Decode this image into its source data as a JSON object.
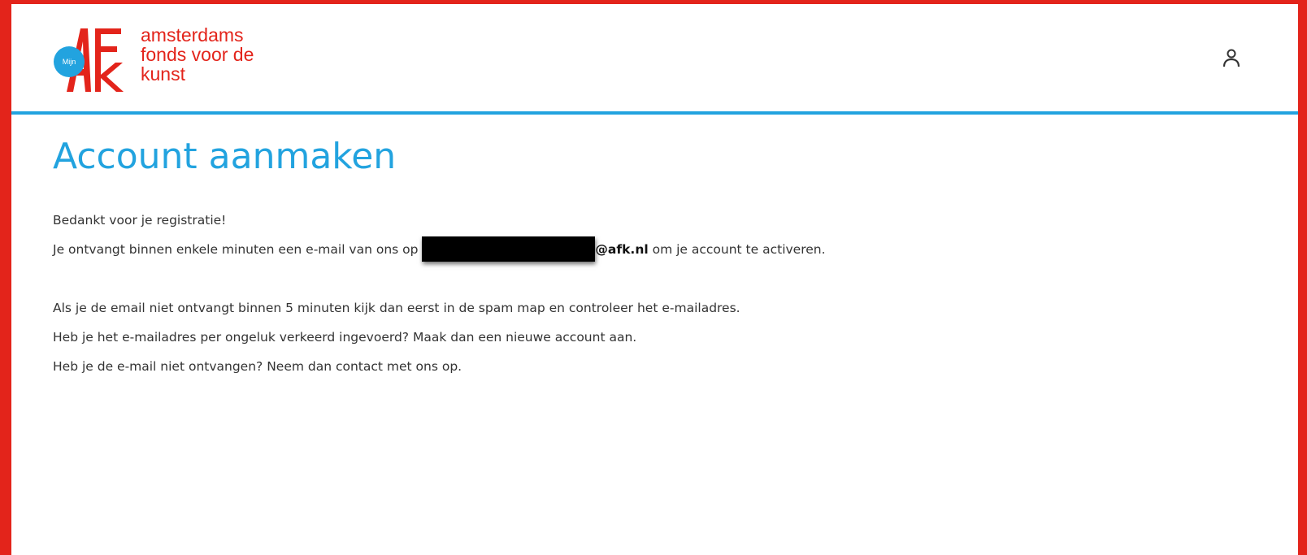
{
  "header": {
    "logo": {
      "badge_text": "Mijn",
      "letters": "AFK",
      "lines": [
        "amsterdams",
        "fonds voor de",
        "kunst"
      ]
    },
    "user_icon": "user-icon"
  },
  "main": {
    "title": "Account aanmaken",
    "thanks": "Bedankt voor je registratie!",
    "confirm_before": "Je ontvangt binnen enkele minuten een e-mail van ons op ",
    "email_domain": "@afk.nl",
    "confirm_after": " om je account te activeren.",
    "help_lines": [
      "Als je de email niet ontvangt binnen 5 minuten kijk dan eerst in de spam map en controleer het e-mailadres.",
      "Heb je het e-mailadres per ongeluk verkeerd ingevoerd? Maak dan een nieuwe account aan.",
      "Heb je de e-mail niet ontvangen? Neem dan contact met ons op."
    ]
  },
  "colors": {
    "brand_red": "#e3241b",
    "accent_blue": "#22a3df",
    "text": "#333333"
  }
}
